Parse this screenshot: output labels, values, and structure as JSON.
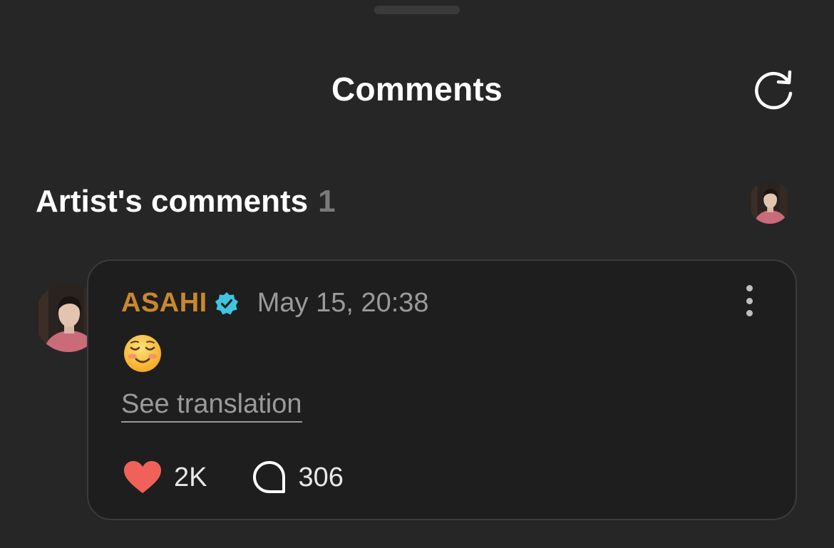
{
  "header": {
    "title": "Comments"
  },
  "section": {
    "title": "Artist's comments",
    "count": "1"
  },
  "comment": {
    "author": "ASAHI",
    "timestamp": "May 15, 20:38",
    "text": "☺️",
    "translate_label": "See translation",
    "likes": "2K",
    "replies": "306"
  },
  "icons": {
    "refresh": "refresh-icon",
    "verified": "verified-badge-icon",
    "more": "more-vertical-icon",
    "heart": "heart-icon",
    "reply": "speech-bubble-icon"
  },
  "colors": {
    "background": "#262626",
    "card": "#1e1e1e",
    "author": "#c9882e",
    "verified": "#3ec6e0",
    "heart": "#f0615a",
    "muted": "#9a9a9a"
  }
}
